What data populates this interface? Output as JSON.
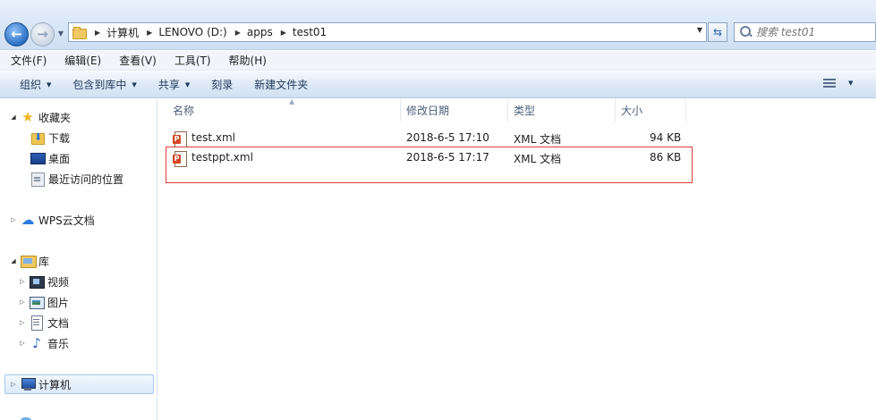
{
  "address_bar": {
    "breadcrumbs": [
      "计算机",
      "LENOVO (D:)",
      "apps",
      "test01"
    ],
    "search_placeholder": "搜索 test01"
  },
  "menu": {
    "items": [
      "文件(F)",
      "编辑(E)",
      "查看(V)",
      "工具(T)",
      "帮助(H)"
    ]
  },
  "toolbar": {
    "organize": "组织",
    "include_in_library": "包含到库中",
    "share": "共享",
    "burn": "刻录",
    "new_folder": "新建文件夹"
  },
  "nav": {
    "favorites": "收藏夹",
    "downloads": "下载",
    "desktop": "桌面",
    "recent": "最近访问的位置",
    "wps_cloud": "WPS云文档",
    "libraries": "库",
    "videos": "视频",
    "pictures": "图片",
    "documents": "文档",
    "music": "音乐",
    "computer": "计算机"
  },
  "columns": {
    "name": "名称",
    "modified": "修改日期",
    "type": "类型",
    "size": "大小"
  },
  "files": [
    {
      "name": "test.xml",
      "modified": "2018-6-5 17:10",
      "type": "XML 文档",
      "size": "94 KB"
    },
    {
      "name": "testppt.xml",
      "modified": "2018-6-5 17:17",
      "type": "XML 文档",
      "size": "86 KB"
    }
  ],
  "colors": {
    "highlight_border": "#e03a3a",
    "nav_selected": "#dbeafb"
  }
}
